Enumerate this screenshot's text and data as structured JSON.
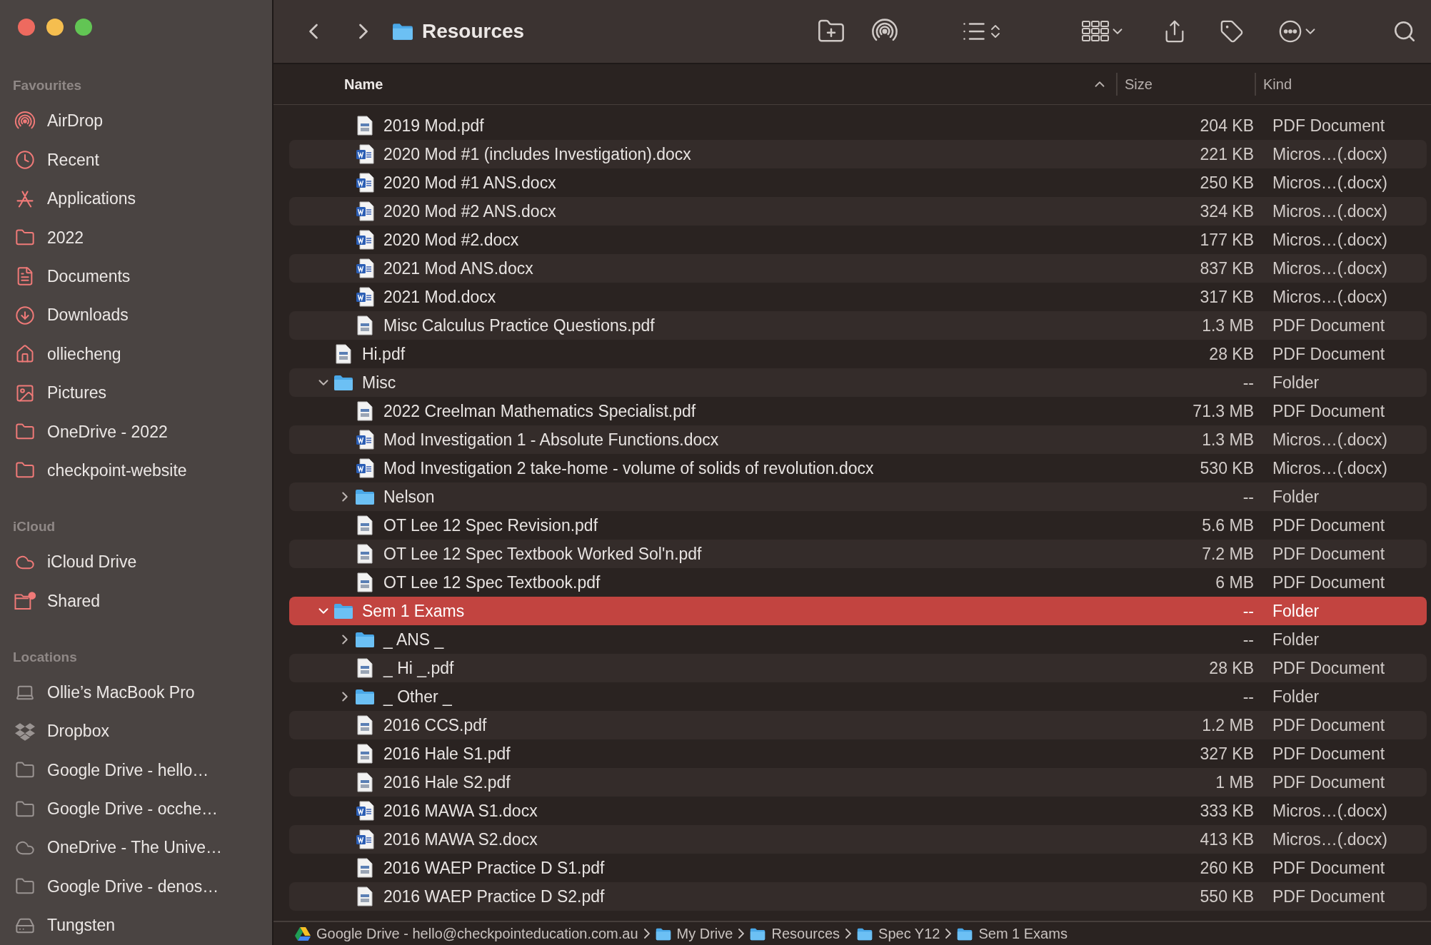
{
  "window": {
    "title": "Resources"
  },
  "sidebar": {
    "sections": [
      {
        "title": "Favourites",
        "items": [
          {
            "label": "AirDrop"
          },
          {
            "label": "Recent"
          },
          {
            "label": "Applications"
          },
          {
            "label": "2022"
          },
          {
            "label": "Documents"
          },
          {
            "label": "Downloads"
          },
          {
            "label": "olliecheng"
          },
          {
            "label": "Pictures"
          },
          {
            "label": "OneDrive - 2022"
          },
          {
            "label": "checkpoint-website"
          }
        ]
      },
      {
        "title": "iCloud",
        "items": [
          {
            "label": "iCloud Drive"
          },
          {
            "label": "Shared"
          }
        ]
      },
      {
        "title": "Locations",
        "items": [
          {
            "label": "Ollie’s MacBook Pro"
          },
          {
            "label": "Dropbox"
          },
          {
            "label": "Google Drive - hello…"
          },
          {
            "label": "Google Drive - ocche…"
          },
          {
            "label": "OneDrive - The Unive…"
          },
          {
            "label": "Google Drive - denos…"
          },
          {
            "label": "Tungsten"
          }
        ]
      }
    ]
  },
  "table": {
    "columns": [
      {
        "label": "Name",
        "sorted": true
      },
      {
        "label": "Size",
        "sorted": false
      },
      {
        "label": "Kind",
        "sorted": false
      }
    ],
    "rows": [
      {
        "children": [
          {
            "kind": "pdf",
            "name": "2019 Mod.pdf",
            "size": "204 KB",
            "type": "PDF Document",
            "selected": false
          },
          {
            "kind": "word",
            "name": "2020 Mod #1 (includes Investigation).docx",
            "size": "221 KB",
            "type": "Micros…(.docx)",
            "selected": false
          },
          {
            "kind": "word",
            "name": "2020 Mod #1 ANS.docx",
            "size": "250 KB",
            "type": "Micros…(.docx)",
            "selected": false
          },
          {
            "kind": "word",
            "name": "2020 Mod #2 ANS.docx",
            "size": "324 KB",
            "type": "Micros…(.docx)",
            "selected": false
          },
          {
            "kind": "word",
            "name": "2020 Mod #2.docx",
            "size": "177 KB",
            "type": "Micros…(.docx)",
            "selected": false
          },
          {
            "kind": "word",
            "name": "2021 Mod ANS.docx",
            "size": "837 KB",
            "type": "Micros…(.docx)",
            "selected": false
          },
          {
            "kind": "word",
            "name": "2021 Mod.docx",
            "size": "317 KB",
            "type": "Micros…(.docx)",
            "selected": false
          },
          {
            "kind": "pdf",
            "name": "Misc Calculus Practice Questions.pdf",
            "size": "1.3 MB",
            "type": "PDF Document",
            "selected": false
          }
        ]
      },
      {
        "kind": "pdf",
        "name": "Hi.pdf",
        "size": "28 KB",
        "type": "PDF Document",
        "selected": false
      },
      {
        "kind": "folder",
        "name": "Misc",
        "size": "--",
        "type": "Folder",
        "selected": false,
        "expanded": true,
        "children": [
          {
            "kind": "pdf",
            "name": "2022 Creelman Mathematics Specialist.pdf",
            "size": "71.3 MB",
            "type": "PDF Document",
            "selected": false
          },
          {
            "kind": "word",
            "name": "Mod Investigation 1 - Absolute Functions.docx",
            "size": "1.3 MB",
            "type": "Micros…(.docx)",
            "selected": false
          },
          {
            "kind": "word",
            "name": "Mod Investigation 2 take-home - volume of solids of revolution.docx",
            "size": "530 KB",
            "type": "Micros…(.docx)",
            "selected": false
          },
          {
            "kind": "folder",
            "name": "Nelson",
            "size": "--",
            "type": "Folder",
            "selected": false,
            "expanded": false
          },
          {
            "kind": "pdf",
            "name": "OT Lee 12 Spec Revision.pdf",
            "size": "5.6 MB",
            "type": "PDF Document",
            "selected": false
          },
          {
            "kind": "pdf",
            "name": "OT Lee 12 Spec Textbook Worked Sol'n.pdf",
            "size": "7.2 MB",
            "type": "PDF Document",
            "selected": false
          },
          {
            "kind": "pdf",
            "name": "OT Lee 12 Spec Textbook.pdf",
            "size": "6 MB",
            "type": "PDF Document",
            "selected": false
          }
        ]
      },
      {
        "kind": "folder",
        "name": "Sem 1 Exams",
        "size": "--",
        "type": "Folder",
        "selected": true,
        "expanded": true,
        "children": [
          {
            "kind": "folder",
            "name": "_ ANS _",
            "size": "--",
            "type": "Folder",
            "selected": false,
            "expanded": false
          },
          {
            "kind": "pdf",
            "name": "_ Hi _.pdf",
            "size": "28 KB",
            "type": "PDF Document",
            "selected": false
          },
          {
            "kind": "folder",
            "name": "_ Other _",
            "size": "--",
            "type": "Folder",
            "selected": false,
            "expanded": false
          },
          {
            "kind": "pdf",
            "name": "2016 CCS.pdf",
            "size": "1.2 MB",
            "type": "PDF Document",
            "selected": false
          },
          {
            "kind": "pdf",
            "name": "2016 Hale S1.pdf",
            "size": "327 KB",
            "type": "PDF Document",
            "selected": false
          },
          {
            "kind": "pdf",
            "name": "2016 Hale S2.pdf",
            "size": "1 MB",
            "type": "PDF Document",
            "selected": false
          },
          {
            "kind": "word",
            "name": "2016 MAWA S1.docx",
            "size": "333 KB",
            "type": "Micros…(.docx)",
            "selected": false
          },
          {
            "kind": "word",
            "name": "2016 MAWA S2.docx",
            "size": "413 KB",
            "type": "Micros…(.docx)",
            "selected": false
          },
          {
            "kind": "pdf",
            "name": "2016 WAEP Practice D S1.pdf",
            "size": "260 KB",
            "type": "PDF Document",
            "selected": false
          },
          {
            "kind": "pdf",
            "name": "2016 WAEP Practice D S2.pdf",
            "size": "550 KB",
            "type": "PDF Document",
            "selected": false
          }
        ]
      }
    ]
  },
  "path_bar": [
    {
      "kind": "drive",
      "label": "Google Drive - hello@checkpointeducation.com.au"
    },
    {
      "kind": "folder",
      "label": "My Drive"
    },
    {
      "kind": "folder",
      "label": "Resources"
    },
    {
      "kind": "folder",
      "label": "Spec Y12"
    },
    {
      "kind": "folder",
      "label": "Sem 1 Exams"
    }
  ]
}
